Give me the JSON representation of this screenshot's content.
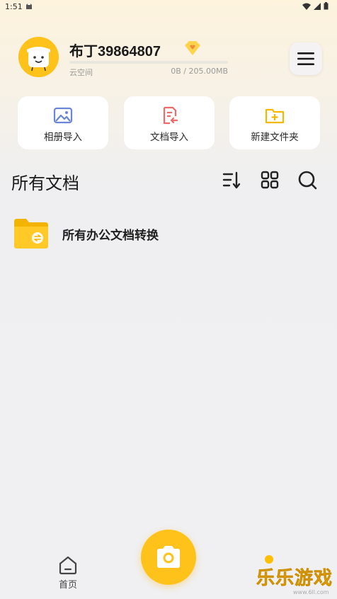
{
  "status_bar": {
    "time": "1:51"
  },
  "profile": {
    "username": "布丁39864807",
    "storage_label": "云空间",
    "storage_usage": "0B / 205.00MB",
    "storage_used_fraction": 0
  },
  "actions": [
    {
      "label": "相册导入",
      "icon": "image-icon",
      "color": "#6b86d6"
    },
    {
      "label": "文档导入",
      "icon": "document-import-icon",
      "color": "#f06a6a"
    },
    {
      "label": "新建文件夹",
      "icon": "new-folder-icon",
      "color": "#f5b800"
    }
  ],
  "section": {
    "title": "所有文档"
  },
  "folders": [
    {
      "name": "所有办公文档转换"
    }
  ],
  "bottom_nav": {
    "home_label": "首页"
  },
  "watermark": {
    "text": "乐乐游戏",
    "url": "www.6ll.com"
  },
  "colors": {
    "accent": "#ffc21a",
    "background": "#f0f0f2"
  }
}
